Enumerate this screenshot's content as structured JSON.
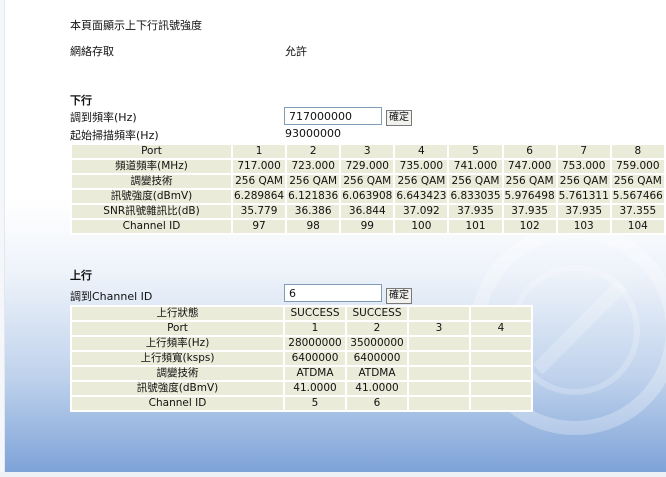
{
  "header": {
    "description": "本頁面顯示上下行訊號強度",
    "network_access_label": "網絡存取",
    "network_access_value": "允許"
  },
  "downstream": {
    "section_title": "下行",
    "tune_freq_label": "調到頻率(Hz)",
    "tune_freq_value": "717000000",
    "confirm_label": "確定",
    "start_scan_label": "起始掃描頻率(Hz)",
    "start_scan_value": "93000000",
    "rows": [
      {
        "label": "Port",
        "cells": [
          "1",
          "2",
          "3",
          "4",
          "5",
          "6",
          "7",
          "8"
        ]
      },
      {
        "label": "頻道頻率(MHz)",
        "cells": [
          "717.000",
          "723.000",
          "729.000",
          "735.000",
          "741.000",
          "747.000",
          "753.000",
          "759.000"
        ]
      },
      {
        "label": "調變技術",
        "cells": [
          "256 QAM",
          "256 QAM",
          "256 QAM",
          "256 QAM",
          "256 QAM",
          "256 QAM",
          "256 QAM",
          "256 QAM"
        ]
      },
      {
        "label": "訊號強度(dBmV)",
        "cells": [
          "6.289864",
          "6.121836",
          "6.063908",
          "6.643423",
          "6.833035",
          "5.976498",
          "5.761311",
          "5.567466"
        ]
      },
      {
        "label": "SNR訊號雜訊比(dB)",
        "cells": [
          "35.779",
          "36.386",
          "36.844",
          "37.092",
          "37.935",
          "37.935",
          "37.935",
          "37.355"
        ]
      },
      {
        "label": "Channel ID",
        "cells": [
          "97",
          "98",
          "99",
          "100",
          "101",
          "102",
          "103",
          "104"
        ]
      }
    ]
  },
  "upstream": {
    "section_title": "上行",
    "channel_label": "調到Channel ID",
    "channel_value": "6",
    "confirm_label": "確定",
    "rows": [
      {
        "label": "上行狀態",
        "cells": [
          "SUCCESS",
          "SUCCESS",
          "",
          ""
        ]
      },
      {
        "label": "Port",
        "cells": [
          "1",
          "2",
          "3",
          "4"
        ]
      },
      {
        "label": "上行頻率(Hz)",
        "cells": [
          "28000000",
          "35000000",
          "",
          ""
        ]
      },
      {
        "label": "上行頻寬(ksps)",
        "cells": [
          "6400000",
          "6400000",
          "",
          ""
        ]
      },
      {
        "label": "調變技術",
        "cells": [
          "ATDMA",
          "ATDMA",
          "",
          ""
        ]
      },
      {
        "label": "訊號強度(dBmV)",
        "cells": [
          "41.0000",
          "41.0000",
          "",
          ""
        ]
      },
      {
        "label": "Channel ID",
        "cells": [
          "5",
          "6",
          "",
          ""
        ]
      }
    ]
  }
}
